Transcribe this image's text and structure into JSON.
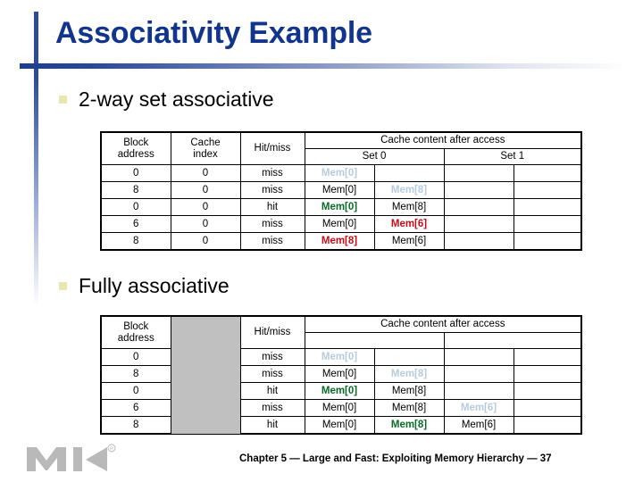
{
  "slide": {
    "title": "Associativity Example",
    "accent_color": "#11348c",
    "bullet_color": "#e9e6b0"
  },
  "sections": [
    {
      "bullet_label": "2-way set associative",
      "table": {
        "headers": {
          "col1_line1": "Block",
          "col1_line2": "address",
          "col2_line1": "Cache",
          "col2_line2": "index",
          "col3": "Hit/miss",
          "content_group": "Cache content after access",
          "set0": "Set 0",
          "set1": "Set 1"
        },
        "rows": [
          {
            "block_address": "0",
            "cache_index": "0",
            "hitmiss": "miss",
            "cells": [
              {
                "text": "Mem[0]",
                "style": "v-new"
              },
              {
                "text": "",
                "style": "v-norm"
              },
              {
                "text": "",
                "style": "v-norm"
              },
              {
                "text": "",
                "style": "v-norm"
              }
            ]
          },
          {
            "block_address": "8",
            "cache_index": "0",
            "hitmiss": "miss",
            "cells": [
              {
                "text": "Mem[0]",
                "style": "v-norm"
              },
              {
                "text": "Mem[8]",
                "style": "v-new"
              },
              {
                "text": "",
                "style": "v-norm"
              },
              {
                "text": "",
                "style": "v-norm"
              }
            ]
          },
          {
            "block_address": "0",
            "cache_index": "0",
            "hitmiss": "hit",
            "cells": [
              {
                "text": "Mem[0]",
                "style": "v-hit"
              },
              {
                "text": "Mem[8]",
                "style": "v-norm"
              },
              {
                "text": "",
                "style": "v-norm"
              },
              {
                "text": "",
                "style": "v-norm"
              }
            ]
          },
          {
            "block_address": "6",
            "cache_index": "0",
            "hitmiss": "miss",
            "cells": [
              {
                "text": "Mem[0]",
                "style": "v-norm"
              },
              {
                "text": "Mem[6]",
                "style": "v-repl"
              },
              {
                "text": "",
                "style": "v-norm"
              },
              {
                "text": "",
                "style": "v-norm"
              }
            ]
          },
          {
            "block_address": "8",
            "cache_index": "0",
            "hitmiss": "miss",
            "cells": [
              {
                "text": "Mem[8]",
                "style": "v-repl"
              },
              {
                "text": "Mem[6]",
                "style": "v-norm"
              },
              {
                "text": "",
                "style": "v-norm"
              },
              {
                "text": "",
                "style": "v-norm"
              }
            ]
          }
        ]
      }
    },
    {
      "bullet_label": "Fully associative",
      "table": {
        "headers": {
          "col1_line1": "Block",
          "col1_line2": "address",
          "col2_line1": "",
          "col2_line2": "",
          "col3": "Hit/miss",
          "content_group": "Cache content after access",
          "set0": "",
          "set1": ""
        },
        "rows": [
          {
            "block_address": "0",
            "cache_index": "",
            "hitmiss": "miss",
            "cells": [
              {
                "text": "Mem[0]",
                "style": "v-new"
              },
              {
                "text": "",
                "style": "v-norm"
              },
              {
                "text": "",
                "style": "v-norm"
              },
              {
                "text": "",
                "style": "v-norm"
              }
            ]
          },
          {
            "block_address": "8",
            "cache_index": "",
            "hitmiss": "miss",
            "cells": [
              {
                "text": "Mem[0]",
                "style": "v-norm"
              },
              {
                "text": "Mem[8]",
                "style": "v-new"
              },
              {
                "text": "",
                "style": "v-norm"
              },
              {
                "text": "",
                "style": "v-norm"
              }
            ]
          },
          {
            "block_address": "0",
            "cache_index": "",
            "hitmiss": "hit",
            "cells": [
              {
                "text": "Mem[0]",
                "style": "v-hit"
              },
              {
                "text": "Mem[8]",
                "style": "v-norm"
              },
              {
                "text": "",
                "style": "v-norm"
              },
              {
                "text": "",
                "style": "v-norm"
              }
            ]
          },
          {
            "block_address": "6",
            "cache_index": "",
            "hitmiss": "miss",
            "cells": [
              {
                "text": "Mem[0]",
                "style": "v-norm"
              },
              {
                "text": "Mem[8]",
                "style": "v-norm"
              },
              {
                "text": "Mem[6]",
                "style": "v-new"
              },
              {
                "text": "",
                "style": "v-norm"
              }
            ]
          },
          {
            "block_address": "8",
            "cache_index": "",
            "hitmiss": "hit",
            "cells": [
              {
                "text": "Mem[0]",
                "style": "v-norm"
              },
              {
                "text": "Mem[8]",
                "style": "v-hit"
              },
              {
                "text": "Mem[6]",
                "style": "v-norm"
              },
              {
                "text": "",
                "style": "v-norm"
              }
            ]
          }
        ]
      }
    }
  ],
  "footer": {
    "text": "Chapter 5 — Large and Fast: Exploiting Memory Hierarchy — 37",
    "logo_alt": "MK",
    "logo_trademark": "®"
  }
}
